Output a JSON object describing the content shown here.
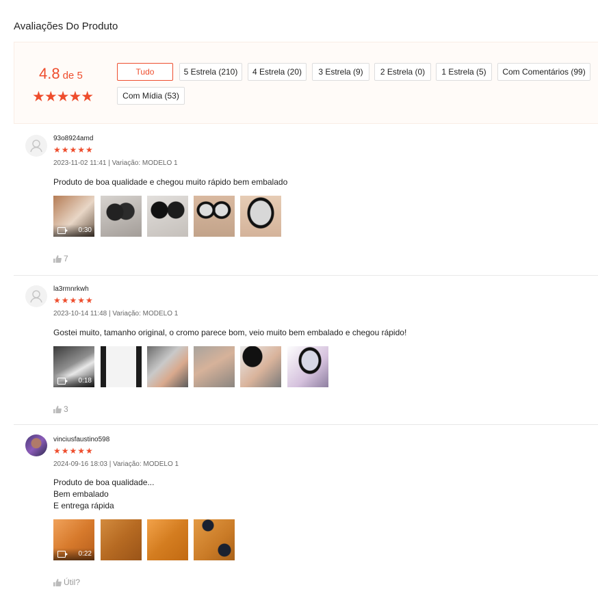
{
  "page": {
    "title": "Avaliações Do Produto"
  },
  "overview": {
    "score": "4.8",
    "out_of": "de 5",
    "stars": "★★★★★",
    "filters": [
      "Tudo",
      "5 Estrela (210)",
      "4 Estrela (20)",
      "3 Estrela (9)",
      "2 Estrela (0)",
      "1 Estrela (5)",
      "Com Comentários (99)",
      "Com Mídia (53)"
    ],
    "active_filter": "Tudo"
  },
  "reviews": [
    {
      "username": "93o8924amd",
      "stars": "★★★★★",
      "meta": "2023-11-02 11:41 | Variação: MODELO 1",
      "comment": "Produto de boa qualidade e chegou muito rápido bem embalado",
      "video_duration": "0:30",
      "likes": "7"
    },
    {
      "username": "la3rmnrkwh",
      "stars": "★★★★★",
      "meta": "2023-10-14 11:48 | Variação: MODELO 1",
      "comment": "Gostei muito, tamanho original, o cromo parece bom, veio muito bem embalado e chegou rápido!",
      "video_duration": "0:18",
      "likes": "3"
    },
    {
      "username": "vinciusfaustino598",
      "stars": "★★★★★",
      "meta": "2024-09-16 18:03 | Variação: MODELO 1",
      "comment": "Produto de boa qualidade...\nBem embalado\nE entrega rápida",
      "video_duration": "0:22",
      "likes": "Útil?"
    }
  ],
  "colors": {
    "accent": "#ee4d2d",
    "panel": "#fffbf8"
  }
}
